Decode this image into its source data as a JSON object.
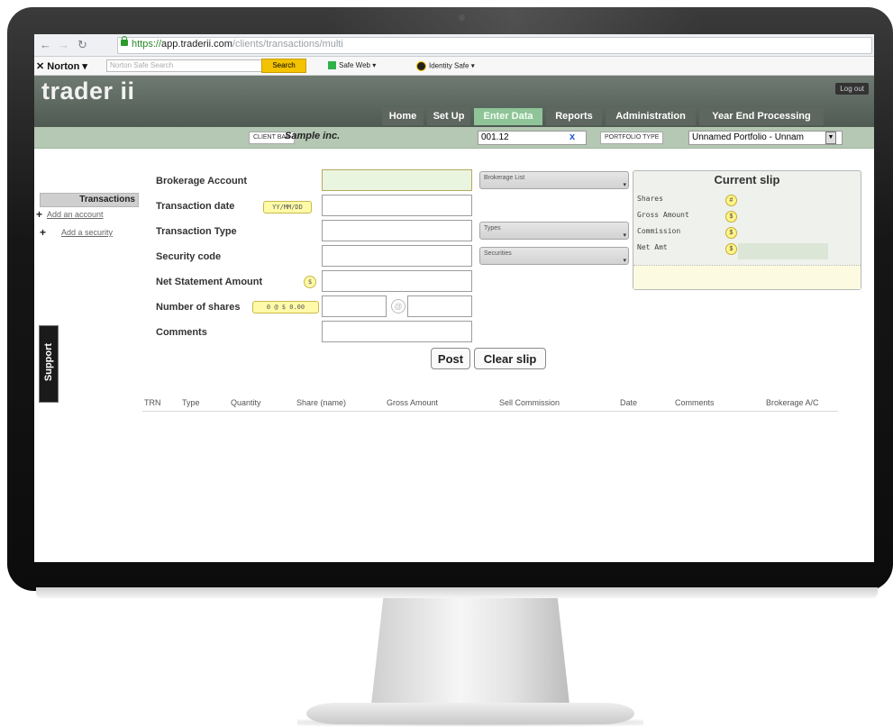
{
  "browser": {
    "url_scheme": "https://",
    "url_host": "app.traderii.com",
    "url_path": "/clients/transactions/multi"
  },
  "norton": {
    "brand": "Norton",
    "search_placeholder": "Norton Safe Search",
    "search_button": "Search",
    "safe_web": "Safe Web",
    "identity_safe": "Identity Safe"
  },
  "app": {
    "logo": "trader ii",
    "logout": "Log out",
    "tabs": [
      "Home",
      "Set Up",
      "Enter Data",
      "Reports",
      "Administration",
      "Year End Processing"
    ],
    "active_tab": "Enter Data"
  },
  "client_bar": {
    "client_label": "CLIENT BAR",
    "client_name": "Sample inc.",
    "code": "001.12",
    "clear_symbol": "x",
    "portfolio_label": "PORTFOLIO TYPE",
    "portfolio_value": "Unnamed Portfolio - Unnam"
  },
  "sidebar": {
    "heading": "Transactions",
    "links": [
      "Add an account",
      "Add a security"
    ],
    "support": "Support"
  },
  "form": {
    "brokerage_account": "Brokerage Account",
    "transaction_date": "Transaction date",
    "date_hint": "YY/MM/DD",
    "transaction_type": "Transaction Type",
    "security_code": "Security code",
    "net_statement_amount": "Net Statement Amount",
    "dollar": "$",
    "number_of_shares": "Number of shares",
    "shares_hint": "0 @ $ 0.00",
    "at_symbol": "@",
    "comments": "Comments",
    "dropdowns": [
      "Brokerage List",
      "Types",
      "Securities"
    ],
    "post": "Post",
    "clear_slip": "Clear slip"
  },
  "current_slip": {
    "title": "Current slip",
    "rows": [
      {
        "label": "Shares",
        "symbol": "#"
      },
      {
        "label": "Gross Amount",
        "symbol": "$"
      },
      {
        "label": "Commission",
        "symbol": "$"
      },
      {
        "label": "Net Amt",
        "symbol": "$"
      }
    ]
  },
  "table": {
    "columns": [
      "TRN",
      "Type",
      "Quantity",
      "Share (name)",
      "Gross Amount",
      "Sell Commission",
      "Date",
      "Comments",
      "Brokerage A/C"
    ]
  },
  "colors": {
    "header_bg": "#5a655c",
    "active_tab": "#8fc398",
    "client_bar": "#b4c8b4",
    "badge": "#fffaa8"
  }
}
